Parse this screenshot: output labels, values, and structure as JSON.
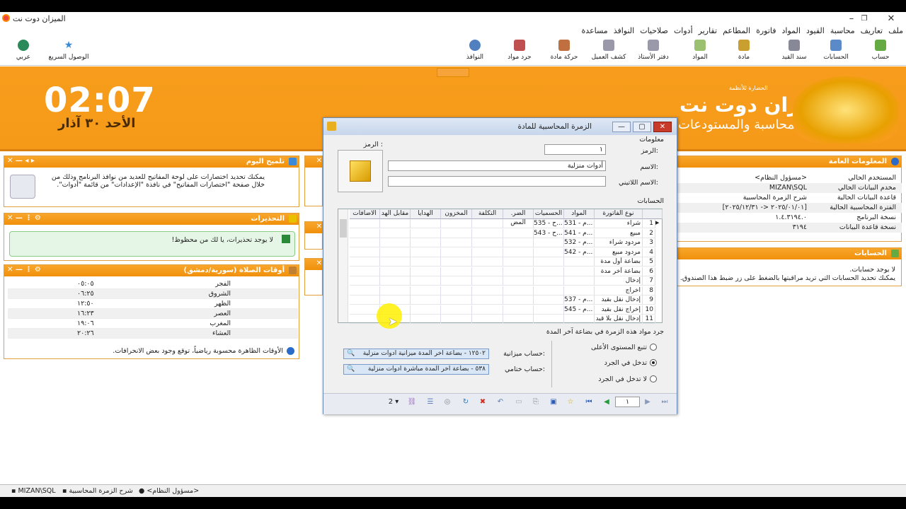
{
  "window": {
    "title": "الميزان دوت نت"
  },
  "menu": [
    "ملف",
    "تعاريف",
    "محاسبة",
    "القيود",
    "المواد",
    "فاتورة",
    "المطاعم",
    "تقارير",
    "أدوات",
    "صلاحيات",
    "النوافذ",
    "مساعدة"
  ],
  "toolbar": {
    "items": [
      "حساب",
      "الحسابات",
      "سند القيد",
      "مادة",
      "المواد",
      "دفتر الأستاذ",
      "كشف العميل",
      "حركة مادة",
      "جرد مواد",
      "النوافذ"
    ],
    "left_items": [
      "الوصول السريع",
      "عربي"
    ]
  },
  "banner": {
    "time": "02:07",
    "date": "الأحد ٣٠ آذار",
    "brand": "الميزان دوت نت",
    "brand_sub": "للمحاسبة والمستودعات",
    "brand_tag": "الحضارة للأنظمة"
  },
  "tip_panel": {
    "title": "تلميح اليوم",
    "text": "يمكنك تحديد اختصارات على لوحة المفاتيح للعديد من نوافذ البرنامج وذلك من خلال صفحة \"اختصارات المفاتيح\" في نافذة \"الإعدادات\" من قائمة \"أدوات\"."
  },
  "warnings_panel": {
    "title": "التحذيرات",
    "text": "لا يوجد تحذيرات، يا لك من محظوظ!"
  },
  "prayer_panel": {
    "title": "أوقات الصلاة (سورية/دمشق)",
    "rows": [
      {
        "name": "الفجر",
        "time": "٠٥:٠٥"
      },
      {
        "name": "الشروق",
        "time": "٠٦:٢٥"
      },
      {
        "name": "الظهر",
        "time": "١٢:٥٠"
      },
      {
        "name": "العصر",
        "time": "١٦:٢٣"
      },
      {
        "name": "المغرب",
        "time": "١٩:٠٦"
      },
      {
        "name": "العشاء",
        "time": "٢٠:٢٦"
      }
    ],
    "note": "الأوقات الظاهرة محسوبة رياضياً، توقع وجود بعض الانحرافات."
  },
  "info_panel": {
    "title": "المعلومات العامة",
    "rows": [
      {
        "label": "المستخدم الحالي",
        "value": "<مسؤول النظام>"
      },
      {
        "label": "مخدم البيانات الحالي",
        "value": "MIZAN\\SQL"
      },
      {
        "label": "قاعدة البيانات الحالية",
        "value": "شرح الزمرة المحاسبية"
      },
      {
        "label": "الفترة المحاسبية الحالية",
        "value": "[٢٠٢٥/٠١/٠١ <- ٢٠٢٥/١٢/٣١]"
      },
      {
        "label": "نسخة البرنامج",
        "value": "١.٤.٣١٩٤.٠"
      },
      {
        "label": "نسخة قاعدة البيانات",
        "value": "٣١٩٤"
      }
    ]
  },
  "accounts_panel": {
    "title": "الحسابات",
    "text1": "لا يوجد حسابات.",
    "text2": "يمكنك تحديد الحسابات التي تريد مراقبتها بالضغط على زر ضبط هذا الصندوق."
  },
  "dialog": {
    "title": "الزمرة المحاسبية للمادة",
    "info_label": "معلومات",
    "code_label": "الرمز:",
    "code_value": "١",
    "image_label": "الرمز :",
    "name_label": "الاسم:",
    "name_value": "أدوات منزلية",
    "latin_label": "الاسم اللاتيني:",
    "latin_value": "",
    "accounts_label": "الحسابات",
    "columns": [
      "نوع الفاتورة",
      "المواد",
      "الحسميات",
      "الضر. المض",
      "التكلفة",
      "المخزون",
      "الهدايا",
      "مقابل الهد",
      "الاضافات"
    ],
    "rows": [
      {
        "n": "1",
        "type": "شراء",
        "mat": "531 - م...",
        "disc": "535 - ح..."
      },
      {
        "n": "2",
        "type": "مبيع",
        "mat": "541 - م...",
        "disc": "543 - ح..."
      },
      {
        "n": "3",
        "type": "مردود شراء",
        "mat": "532 - م...",
        "disc": ""
      },
      {
        "n": "4",
        "type": "مردود مبيع",
        "mat": "542 - م...",
        "disc": ""
      },
      {
        "n": "5",
        "type": "بضاعة أول مدة",
        "mat": "",
        "disc": ""
      },
      {
        "n": "6",
        "type": "بضاعة آخر مدة",
        "mat": "",
        "disc": ""
      },
      {
        "n": "7",
        "type": "إدخال",
        "mat": "",
        "disc": ""
      },
      {
        "n": "8",
        "type": "اخراج",
        "mat": "",
        "disc": ""
      },
      {
        "n": "9",
        "type": "إدخال نقل بقيد",
        "mat": "537 - م...",
        "disc": ""
      },
      {
        "n": "10",
        "type": "إخراج نقل بقيد",
        "mat": "545 - م...",
        "disc": ""
      },
      {
        "n": "11",
        "type": "إدخال نقل بلا قيد",
        "mat": "",
        "disc": ""
      }
    ],
    "inventory_label": "جرد مواد هذه الزمرة في بضاعة آخر المدة",
    "radio_options": [
      "تتبع المستوى الأعلى",
      "تدخل في الجرد",
      "لا تدخل في الجرد"
    ],
    "balance_label": "حساب ميزانية:",
    "balance_value": "١٢٥٠٢ - بضاعة اخر المدة ميزانية ادوات منزلية",
    "closing_label": "حساب ختامي:",
    "closing_value": "٥٣٨ - بضاعة اخر المدة مباشرة ادوات منزلية",
    "record_no": "١",
    "count": "2"
  },
  "statusbar": {
    "server": "MIZAN\\SQL",
    "db": "شرح الزمرة المحاسبية",
    "user": "<مسؤول النظام>"
  }
}
